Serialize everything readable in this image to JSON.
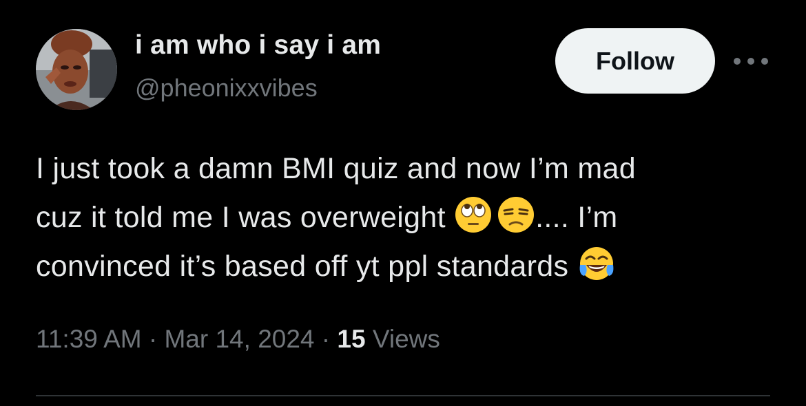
{
  "author": {
    "display_name": "i am who i say i am",
    "handle": "@pheonixxvibes"
  },
  "actions": {
    "follow_label": "Follow",
    "more_icon": "more-horizontal-icon"
  },
  "tweet": {
    "line1": "I just took a damn BMI quiz and now I’m mad",
    "line2_a": "cuz it told me I was overweight ",
    "emoji_1": "face-with-rolling-eyes-icon",
    "emoji_2": "unamused-face-icon",
    "line2_b": ".... I’m",
    "line3": "convinced it’s based off yt ppl standards ",
    "emoji_3": "face-with-tears-of-joy-icon"
  },
  "meta": {
    "time": "11:39 AM",
    "separator": " · ",
    "date": "Mar 14, 2024",
    "views_count": "15",
    "views_label": " Views"
  },
  "colors": {
    "background": "#000000",
    "primary_text": "#e7e9ea",
    "secondary_text": "#71767b",
    "follow_bg": "#eff3f4",
    "divider": "#2f3336"
  }
}
